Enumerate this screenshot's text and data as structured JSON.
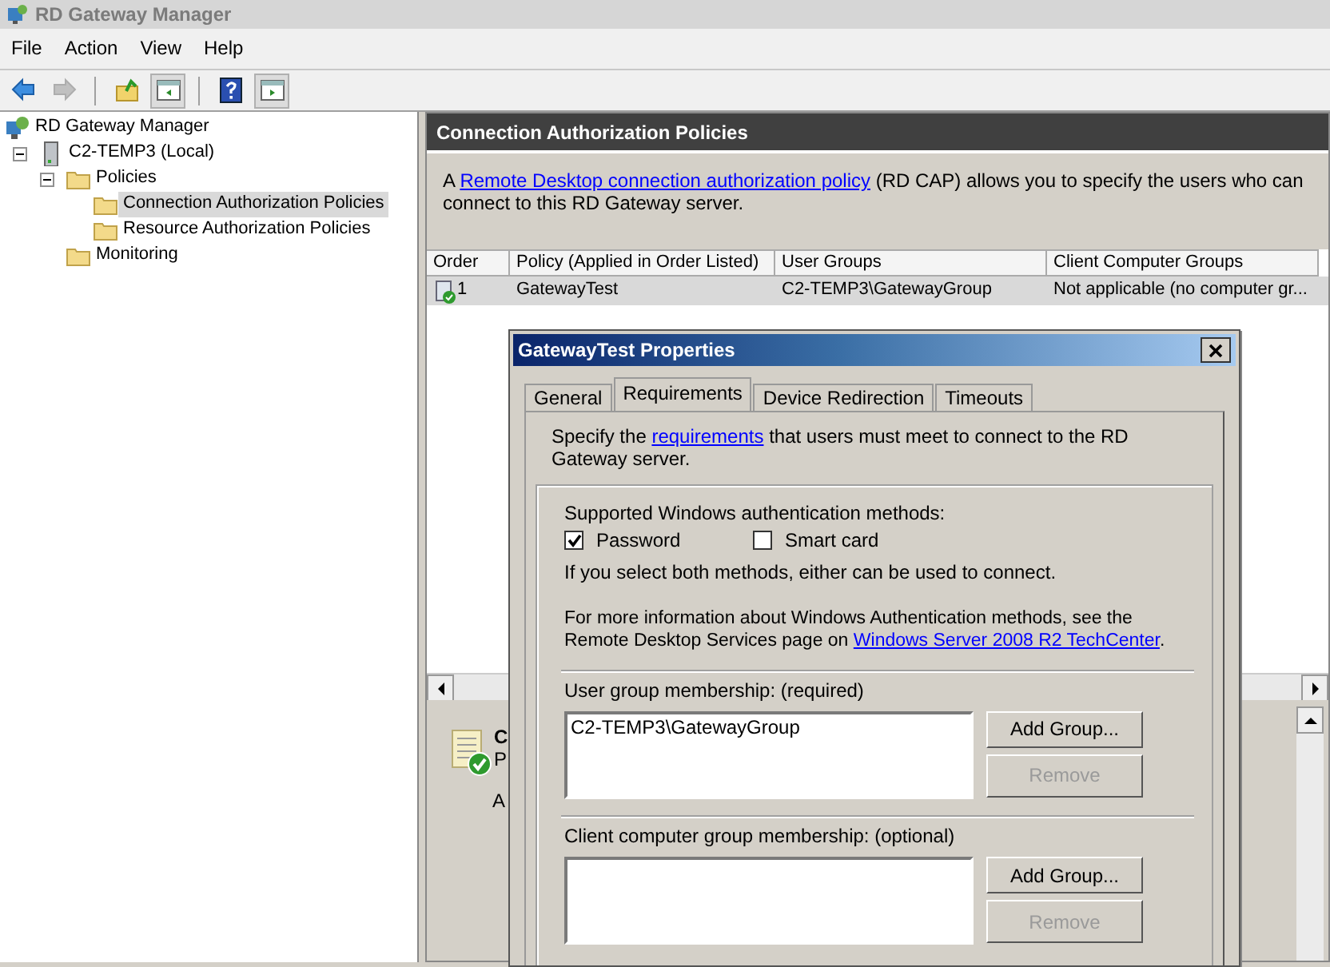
{
  "window": {
    "title": "RD Gateway Manager"
  },
  "menu": [
    "File",
    "Action",
    "View",
    "Help"
  ],
  "toolbar": [
    {
      "kind": "back",
      "disabled": false,
      "pressed": false
    },
    {
      "kind": "forward",
      "disabled": true,
      "pressed": false
    },
    {
      "kind": "up",
      "disabled": false,
      "pressed": false
    },
    {
      "kind": "tree-pane",
      "disabled": false,
      "pressed": true
    },
    {
      "kind": "help",
      "disabled": false,
      "pressed": false
    },
    {
      "kind": "action-pane",
      "disabled": false,
      "pressed": true
    }
  ],
  "tree": [
    {
      "label": "RD Gateway Manager",
      "kind": "root",
      "selected": false,
      "children": [
        {
          "label": "C2-TEMP3 (Local)",
          "kind": "server",
          "expanded": true,
          "selected": false,
          "children": [
            {
              "label": "Policies",
              "kind": "folder",
              "expanded": true,
              "selected": false,
              "children": [
                {
                  "label": "Connection Authorization Policies",
                  "kind": "folder",
                  "selected": true
                },
                {
                  "label": "Resource Authorization Policies",
                  "kind": "folder",
                  "selected": false
                }
              ]
            },
            {
              "label": "Monitoring",
              "kind": "folder",
              "selected": false
            }
          ]
        }
      ]
    }
  ],
  "panel": {
    "title": "Connection Authorization Policies",
    "description": {
      "before": "A ",
      "link": "Remote Desktop connection authorization policy",
      "after": " (RD CAP) allows you to specify the users who can connect to this RD Gateway server."
    },
    "table": {
      "columns": [
        "Order",
        "Policy (Applied in Order Listed)",
        "User Groups",
        "Client Computer Groups"
      ],
      "rows": [
        {
          "cells": [
            "1",
            "GatewayTest",
            "C2-TEMP3\\GatewayGroup",
            "Not applicable (no computer gr..."
          ],
          "selected": true
        }
      ]
    },
    "detail": {
      "title": "C",
      "subtitle": "P",
      "label": "A"
    }
  },
  "dialog": {
    "title": "GatewayTest Properties",
    "tabs": [
      {
        "label": "General",
        "selected": false
      },
      {
        "label": "Requirements",
        "selected": true
      },
      {
        "label": "Device Redirection",
        "selected": false
      },
      {
        "label": "Timeouts",
        "selected": false
      }
    ],
    "intro": {
      "before": "Specify the ",
      "link": "requirements",
      "after": " that users must meet to connect to the RD Gateway server."
    },
    "auth_label": "Supported Windows authentication methods:",
    "methods": [
      {
        "label": "Password",
        "checked": true
      },
      {
        "label": "Smart card",
        "checked": false
      }
    ],
    "auth_note": "If you select both methods, either can be used to connect.",
    "info": {
      "before": "For more information about Windows Authentication methods, see the Remote Desktop Services page on ",
      "link": "Windows Server 2008 R2 TechCenter",
      "after": "."
    },
    "groups": [
      {
        "label": "User group membership: (required)",
        "items": [
          "C2-TEMP3\\GatewayGroup"
        ],
        "buttons": [
          {
            "label": "Add Group...",
            "disabled": false
          },
          {
            "label": "Remove",
            "disabled": true
          }
        ]
      },
      {
        "label": "Client computer group membership: (optional)",
        "buttons": [
          {
            "label": "Add Group...",
            "disabled": false
          },
          {
            "label": "Remove",
            "disabled": true
          }
        ]
      }
    ]
  }
}
